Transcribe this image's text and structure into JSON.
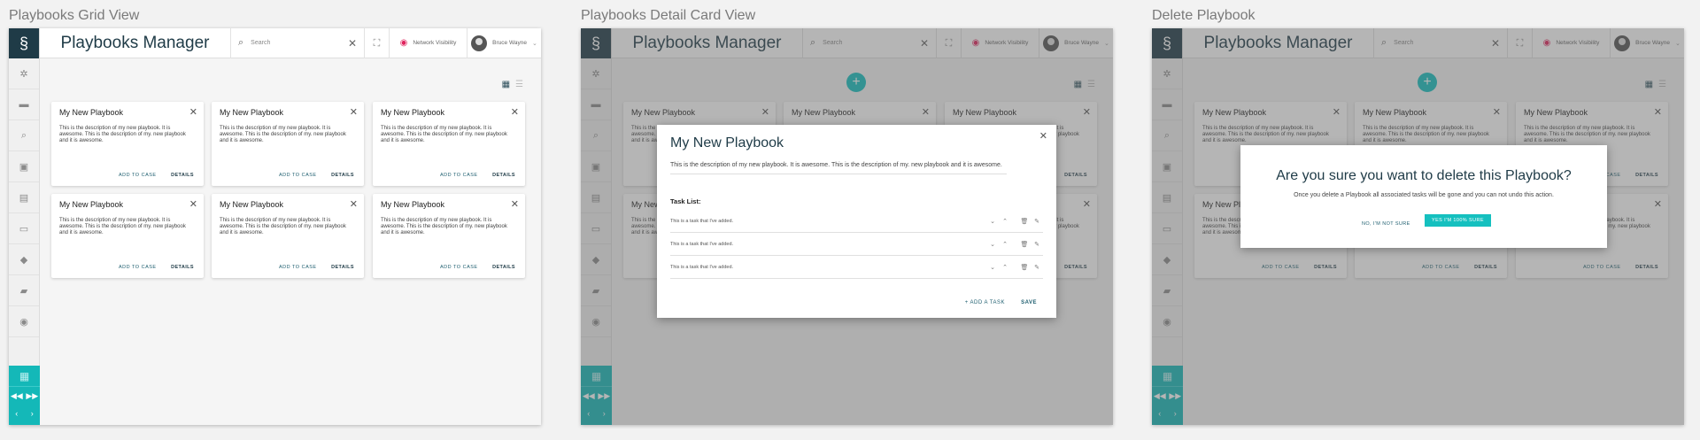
{
  "panels": [
    {
      "title": "Playbooks Grid View"
    },
    {
      "title": "Playbooks Detail Card View"
    },
    {
      "title": "Delete Playbook"
    }
  ],
  "app": {
    "title": "Playbooks Manager",
    "search_placeholder": "Search",
    "network_visibility": "Network Visibility",
    "user_name": "Bruce Wayne"
  },
  "card": {
    "title": "My New Playbook",
    "description": "This is the description of my new playbook. It is awesome. This is the description of my. new playbook and it is awesome.",
    "add_to_case": "ADD TO CASE",
    "details": "DETAILS"
  },
  "detail_dialog": {
    "title": "My New Playbook",
    "description": "This is the description of my new playbook. It is awesome. This is the description of my. new playbook and it is awesome.",
    "task_list_label": "Task List:",
    "tasks": [
      {
        "text": "This is a task that I've added."
      },
      {
        "text": "This is a task that I've added."
      },
      {
        "text": "This is a task that I've added."
      }
    ],
    "add_task": "+ ADD A TASK",
    "save": "SAVE"
  },
  "delete_dialog": {
    "title": "Are you sure you want to delete this Playbook?",
    "message": "Once you delete a Playbook all associated tasks will be gone and you can not undo this action.",
    "no_label": "NO, I'M NOT SURE",
    "yes_label": "YES I'M 100% SURE"
  },
  "icons": {
    "logo": "dragon-logo-icon",
    "search": "search-icon",
    "close": "close-icon",
    "expand": "expand-icon",
    "eye": "eye-icon",
    "grid": "grid-view-icon",
    "list": "list-view-icon",
    "add": "plus-icon"
  },
  "colors": {
    "brand_dark": "#1f3b47",
    "accent_teal": "#15c0bf",
    "eye_pink": "#e0245e"
  }
}
